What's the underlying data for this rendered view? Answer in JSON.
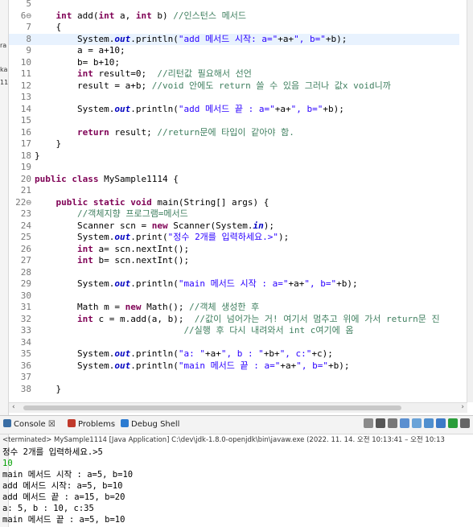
{
  "left_strip": {
    "labels": [
      "ra",
      "ka",
      "11"
    ]
  },
  "editor": {
    "lines": [
      {
        "n": "5",
        "segments": [
          {
            "t": ""
          }
        ]
      },
      {
        "n": "6⊖",
        "segments": [
          {
            "t": "    "
          },
          {
            "c": "kw",
            "t": "int"
          },
          {
            "t": " add("
          },
          {
            "c": "kw",
            "t": "int"
          },
          {
            "t": " a, "
          },
          {
            "c": "kw",
            "t": "int"
          },
          {
            "t": " b) "
          },
          {
            "c": "cm",
            "t": "//인스턴스 메서드"
          }
        ]
      },
      {
        "n": "7",
        "segments": [
          {
            "t": "    {"
          }
        ]
      },
      {
        "n": "8",
        "hl": true,
        "segments": [
          {
            "t": "        System."
          },
          {
            "c": "fld",
            "t": "out"
          },
          {
            "t": ".println("
          },
          {
            "c": "st",
            "t": "\"add 메서드 시작: a=\""
          },
          {
            "t": "+a+"
          },
          {
            "c": "st",
            "t": "\", b=\""
          },
          {
            "t": "+b);"
          }
        ]
      },
      {
        "n": "9",
        "segments": [
          {
            "t": "        a = a+10;"
          }
        ]
      },
      {
        "n": "10",
        "segments": [
          {
            "t": "        b= b+10;"
          }
        ]
      },
      {
        "n": "11",
        "segments": [
          {
            "t": "        "
          },
          {
            "c": "kw",
            "t": "int"
          },
          {
            "t": " result=0;  "
          },
          {
            "c": "cm",
            "t": "//리턴값 필요해서 선언"
          }
        ]
      },
      {
        "n": "12",
        "segments": [
          {
            "t": "        result = a+b; "
          },
          {
            "c": "cm",
            "t": "//void 안에도 return 쓸 수 있음 그러나 값x void니까"
          }
        ]
      },
      {
        "n": "13",
        "segments": [
          {
            "t": ""
          }
        ]
      },
      {
        "n": "14",
        "segments": [
          {
            "t": "        System."
          },
          {
            "c": "fld",
            "t": "out"
          },
          {
            "t": ".println("
          },
          {
            "c": "st",
            "t": "\"add 메서드 끝 : a=\""
          },
          {
            "t": "+a+"
          },
          {
            "c": "st",
            "t": "\", b=\""
          },
          {
            "t": "+b);"
          }
        ]
      },
      {
        "n": "15",
        "segments": [
          {
            "t": ""
          }
        ]
      },
      {
        "n": "16",
        "segments": [
          {
            "t": "        "
          },
          {
            "c": "kw",
            "t": "return"
          },
          {
            "t": " result; "
          },
          {
            "c": "cm",
            "t": "//return문에 타입이 같아야 함."
          }
        ]
      },
      {
        "n": "17",
        "segments": [
          {
            "t": "    }"
          }
        ]
      },
      {
        "n": "18",
        "segments": [
          {
            "t": "}"
          }
        ]
      },
      {
        "n": "19",
        "segments": [
          {
            "t": ""
          }
        ]
      },
      {
        "n": "20",
        "segments": [
          {
            "c": "kw",
            "t": "public class"
          },
          {
            "t": " MySample1114 {"
          }
        ]
      },
      {
        "n": "21",
        "segments": [
          {
            "t": ""
          }
        ]
      },
      {
        "n": "22⊖",
        "segments": [
          {
            "t": "    "
          },
          {
            "c": "kw",
            "t": "public static void"
          },
          {
            "t": " main(String[] args) {"
          }
        ]
      },
      {
        "n": "23",
        "segments": [
          {
            "t": "        "
          },
          {
            "c": "cm",
            "t": "//객체지향 프로그램=메서드"
          }
        ]
      },
      {
        "n": "24",
        "segments": [
          {
            "t": "        Scanner scn = "
          },
          {
            "c": "kw",
            "t": "new"
          },
          {
            "t": " Scanner(System."
          },
          {
            "c": "fld",
            "t": "in"
          },
          {
            "t": ");"
          }
        ]
      },
      {
        "n": "25",
        "segments": [
          {
            "t": "        System."
          },
          {
            "c": "fld",
            "t": "out"
          },
          {
            "t": ".print("
          },
          {
            "c": "st",
            "t": "\"정수 2개를 입력하세요.>\""
          },
          {
            "t": ");"
          }
        ]
      },
      {
        "n": "26",
        "segments": [
          {
            "t": "        "
          },
          {
            "c": "kw",
            "t": "int"
          },
          {
            "t": " a= scn.nextInt();"
          }
        ]
      },
      {
        "n": "27",
        "segments": [
          {
            "t": "        "
          },
          {
            "c": "kw",
            "t": "int"
          },
          {
            "t": " b= scn.nextInt();"
          }
        ]
      },
      {
        "n": "28",
        "segments": [
          {
            "t": ""
          }
        ]
      },
      {
        "n": "29",
        "segments": [
          {
            "t": "        System."
          },
          {
            "c": "fld",
            "t": "out"
          },
          {
            "t": ".println("
          },
          {
            "c": "st",
            "t": "\"main 메서드 시작 : a=\""
          },
          {
            "t": "+a+"
          },
          {
            "c": "st",
            "t": "\", b=\""
          },
          {
            "t": "+b);"
          }
        ]
      },
      {
        "n": "30",
        "segments": [
          {
            "t": ""
          }
        ]
      },
      {
        "n": "31",
        "segments": [
          {
            "t": "        Math m = "
          },
          {
            "c": "kw",
            "t": "new"
          },
          {
            "t": " Math(); "
          },
          {
            "c": "cm",
            "t": "//객체 생성한 후"
          }
        ]
      },
      {
        "n": "32",
        "segments": [
          {
            "t": "        "
          },
          {
            "c": "kw",
            "t": "int"
          },
          {
            "t": " c = m.add(a, b);  "
          },
          {
            "c": "cm",
            "t": "//값이 넘어가는 거! 여기서 멈추고 위에 가서 return문 진"
          }
        ]
      },
      {
        "n": "33",
        "segments": [
          {
            "t": "                            "
          },
          {
            "c": "cm",
            "t": "//실행 후 다시 내려와서 int c여기에 옴"
          }
        ]
      },
      {
        "n": "34",
        "segments": [
          {
            "t": ""
          }
        ]
      },
      {
        "n": "35",
        "segments": [
          {
            "t": "        System."
          },
          {
            "c": "fld",
            "t": "out"
          },
          {
            "t": ".println("
          },
          {
            "c": "st",
            "t": "\"a: \""
          },
          {
            "t": "+a+"
          },
          {
            "c": "st",
            "t": "\", b : \""
          },
          {
            "t": "+b+"
          },
          {
            "c": "st",
            "t": "\", c:\""
          },
          {
            "t": "+c);"
          }
        ]
      },
      {
        "n": "36",
        "segments": [
          {
            "t": "        System."
          },
          {
            "c": "fld",
            "t": "out"
          },
          {
            "t": ".println("
          },
          {
            "c": "st",
            "t": "\"main 메서드 끝 : a=\""
          },
          {
            "t": "+a+"
          },
          {
            "c": "st",
            "t": "\", b=\""
          },
          {
            "t": "+b);"
          }
        ]
      },
      {
        "n": "37",
        "segments": [
          {
            "t": ""
          }
        ]
      },
      {
        "n": "38",
        "segments": [
          {
            "t": "    }"
          }
        ]
      }
    ]
  },
  "console_panel": {
    "tabs": [
      {
        "label": "Console ☒",
        "icon": "console-icon",
        "color": "#3a6ea5"
      },
      {
        "label": "Problems",
        "icon": "problems-icon",
        "color": "#c0392b"
      },
      {
        "label": "Debug Shell",
        "icon": "debug-shell-icon",
        "color": "#2c7bd1"
      }
    ],
    "toolbar_icons": [
      "stop-icon",
      "remove-icon",
      "remove-all-icon",
      "scroll-lock-icon",
      "word-wrap-icon",
      "pin-icon",
      "display-console-icon",
      "new-console-icon",
      "minimize-icon"
    ],
    "terminated": "<terminated> MySample1114 [Java Application] C:\\dev\\jdk-1.8.0-openjdk\\bin\\javaw.exe  (2022. 11. 14. 오전 10:13:41 – 오전 10:13",
    "output": [
      {
        "text": "정수 2개를 입력하세요.>5",
        "input": false
      },
      {
        "text": "10",
        "input": true
      },
      {
        "text": "main 메서드 시작 : a=5, b=10",
        "input": false
      },
      {
        "text": "add 메서드 시작: a=5, b=10",
        "input": false
      },
      {
        "text": "add 메서드 끝 : a=15, b=20",
        "input": false
      },
      {
        "text": "a: 5, b : 10, c:35",
        "input": false
      },
      {
        "text": "main 메서드 끝 : a=5, b=10",
        "input": false
      }
    ]
  }
}
